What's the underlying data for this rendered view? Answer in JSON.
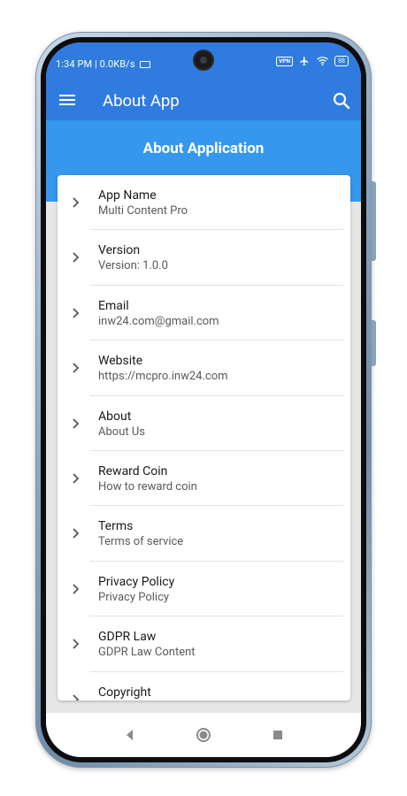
{
  "status_bar": {
    "time": "1:34 PM",
    "network_speed": "0.0KB/s",
    "vpn_label": "VPN",
    "battery": "88"
  },
  "app_bar": {
    "title": "About App"
  },
  "header": {
    "title": "About Application"
  },
  "items": [
    {
      "title": "App Name",
      "subtitle": "Multi Content Pro"
    },
    {
      "title": "Version",
      "subtitle": "Version: 1.0.0"
    },
    {
      "title": "Email",
      "subtitle": "inw24.com@gmail.com"
    },
    {
      "title": "Website",
      "subtitle": "https://mcpro.inw24.com"
    },
    {
      "title": "About",
      "subtitle": "About Us"
    },
    {
      "title": "Reward Coin",
      "subtitle": "How to reward coin"
    },
    {
      "title": "Terms",
      "subtitle": "Terms of service"
    },
    {
      "title": "Privacy Policy",
      "subtitle": "Privacy Policy"
    },
    {
      "title": "GDPR Law",
      "subtitle": "GDPR Law Content"
    },
    {
      "title": "Copyright",
      "subtitle": ""
    }
  ],
  "icons": {
    "menu": "hamburger-menu-icon",
    "search": "search-icon",
    "chevron": "chevron-right-icon",
    "nav_back": "triangle-back-icon",
    "nav_home": "circle-home-icon",
    "nav_recents": "square-recents-icon"
  },
  "colors": {
    "app_bar": "#2f7be0",
    "header_band": "#3597ee",
    "screen_background": "#e6e6e6",
    "card": "#ffffff"
  }
}
